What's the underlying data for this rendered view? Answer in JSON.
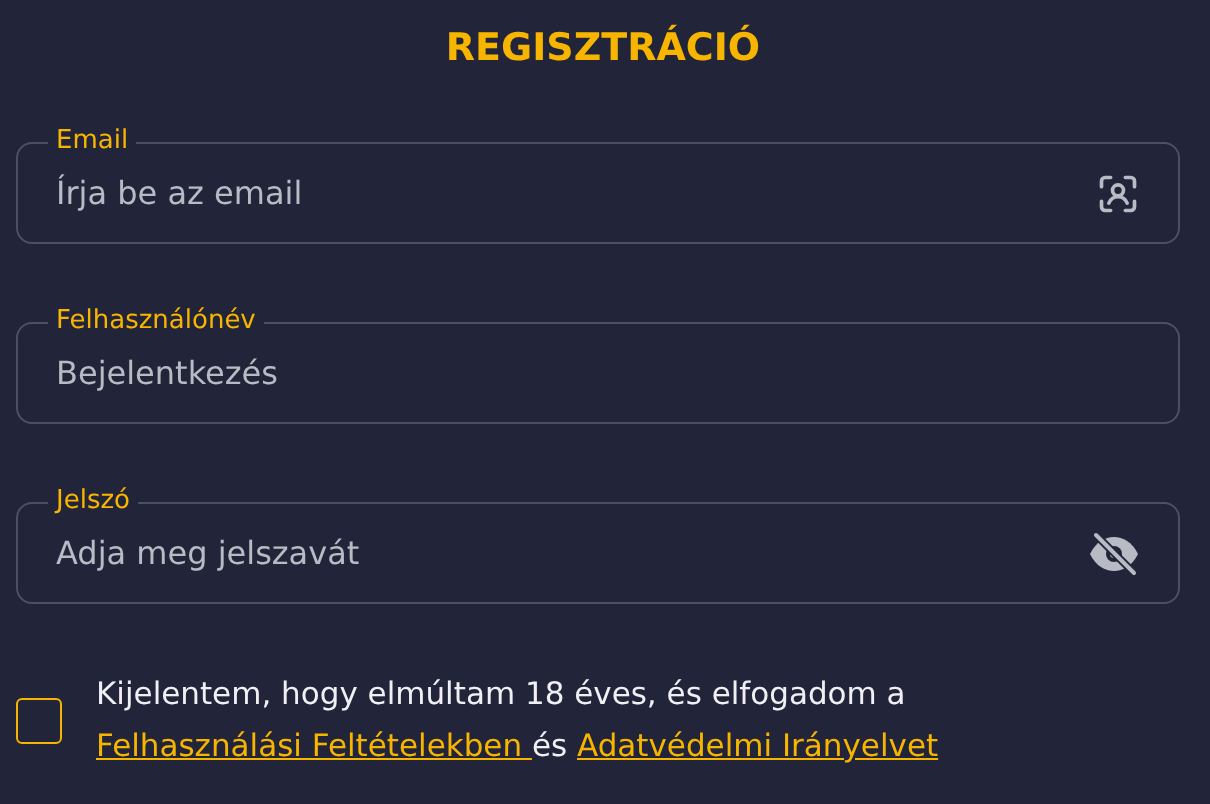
{
  "title": "REGISZTRÁCIÓ",
  "fields": [
    {
      "kind": "email",
      "label": "Email",
      "placeholder": "Írja be az email"
    },
    {
      "kind": "text",
      "label": "Felhasználónév",
      "placeholder": "Bejelentkezés"
    },
    {
      "kind": "password",
      "label": "Jelszó",
      "placeholder": "Adja meg jelszavát"
    }
  ],
  "consent": {
    "checked": false,
    "parts": [
      {
        "kind": "text",
        "text": "Kijelentem, hogy elmúltam 18 éves, és elfogadom a "
      },
      {
        "kind": "link",
        "text": "Felhasználási Feltételekben "
      },
      {
        "kind": "text",
        "text": "és "
      },
      {
        "kind": "link",
        "text": "Adatvédelmi Irányelvet"
      }
    ]
  }
}
